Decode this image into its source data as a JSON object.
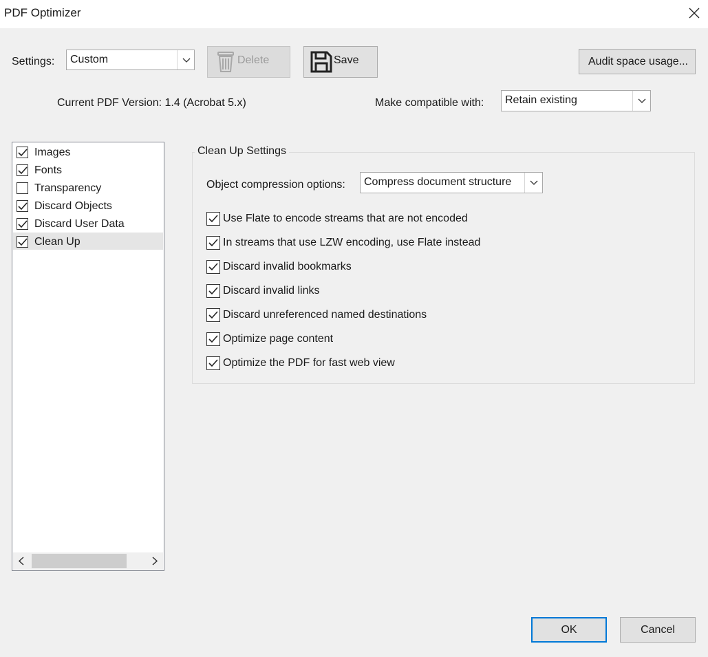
{
  "window": {
    "title": "PDF Optimizer"
  },
  "settings": {
    "label": "Settings:",
    "value": "Custom",
    "delete_label": "Delete",
    "save_label": "Save",
    "audit_label": "Audit space usage..."
  },
  "version": {
    "current": "Current PDF Version: 1.4 (Acrobat 5.x)",
    "compat_label": "Make compatible with:",
    "compat_value": "Retain existing"
  },
  "sidebar": {
    "items": [
      {
        "label": "Images",
        "checked": true
      },
      {
        "label": "Fonts",
        "checked": true
      },
      {
        "label": "Transparency",
        "checked": false
      },
      {
        "label": "Discard Objects",
        "checked": true
      },
      {
        "label": "Discard User Data",
        "checked": true
      },
      {
        "label": "Clean Up",
        "checked": true
      }
    ],
    "selected_index": 5
  },
  "cleanup": {
    "group_title": "Clean Up Settings",
    "compression_label": "Object compression options:",
    "compression_value": "Compress document structure",
    "options": [
      {
        "label": "Use Flate to encode streams that are not encoded",
        "checked": true
      },
      {
        "label": "In streams that use LZW encoding, use Flate instead",
        "checked": true
      },
      {
        "label": "Discard invalid bookmarks",
        "checked": true
      },
      {
        "label": "Discard invalid links",
        "checked": true
      },
      {
        "label": "Discard unreferenced named destinations",
        "checked": true
      },
      {
        "label": "Optimize page content",
        "checked": true
      },
      {
        "label": "Optimize the PDF for fast web view",
        "checked": true
      }
    ]
  },
  "footer": {
    "ok_label": "OK",
    "cancel_label": "Cancel"
  },
  "colors": {
    "accent": "#0078d7",
    "window_bg": "#f0f0f0"
  }
}
